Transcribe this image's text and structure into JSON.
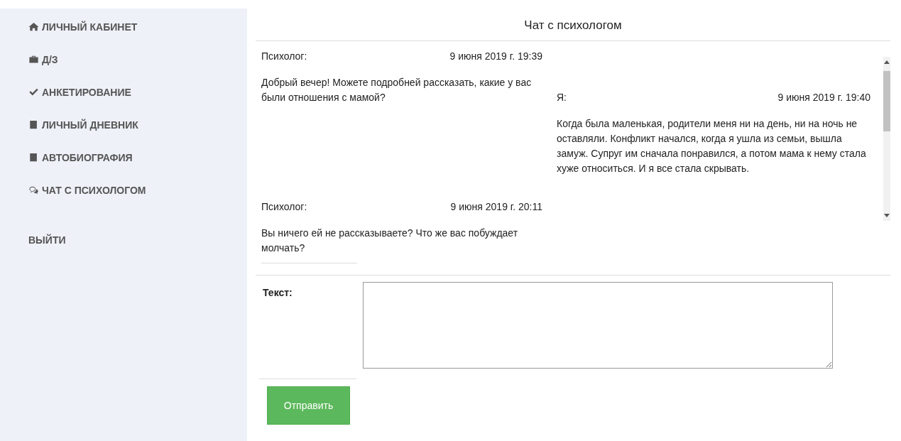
{
  "sidebar": {
    "items": [
      {
        "kind": "home",
        "label": "ЛИЧНЫЙ КАБИНЕТ"
      },
      {
        "kind": "briefcase",
        "label": "Д/З"
      },
      {
        "kind": "check",
        "label": "АНКЕТИРОВАНИЕ"
      },
      {
        "kind": "book",
        "label": "ЛИЧНЫЙ ДНЕВНИК"
      },
      {
        "kind": "book",
        "label": "АВТОБИОГРАФИЯ"
      },
      {
        "kind": "chat",
        "label": "ЧАТ С ПСИХОЛОГОМ"
      },
      {
        "kind": "logout",
        "label": "ВЫЙТИ"
      }
    ]
  },
  "chat": {
    "title": "Чат с психологом",
    "left_messages": [
      {
        "author": "Психолог:",
        "time": "9 июня 2019 г. 19:39",
        "text": "Добрый вечер! Можете подробней рассказать, какие у вас были отношения с мамой?"
      },
      {
        "author": "Психолог:",
        "time": "9 июня 2019 г. 20:11",
        "text": "Вы ничего ей не рассказываете? Что же вас побуждает молчать?"
      }
    ],
    "right_messages": [
      {
        "author": "Я:",
        "time": "9 июня 2019 г. 19:40",
        "text": "Когда была маленькая, родители меня ни на день, ни на ночь не оставляли. Конфликт начался, когда я ушла из семьи, вышла замуж. Супруг им сначала понравился, а потом мама к нему стала хуже относиться. И я все стала скрывать."
      }
    ]
  },
  "form": {
    "label": "Текст:",
    "button": "Отправить"
  }
}
